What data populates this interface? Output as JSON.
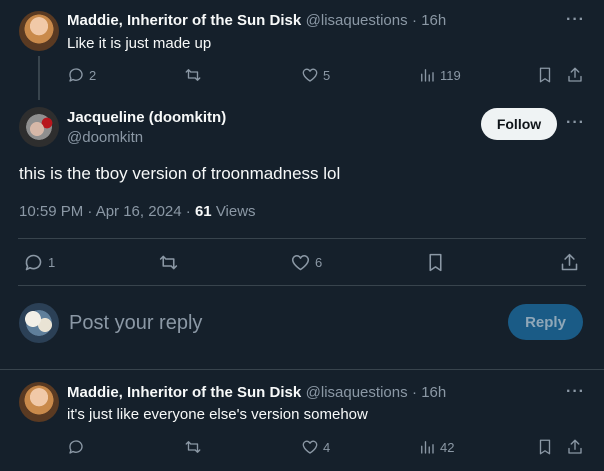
{
  "tweet1": {
    "display_name": "Maddie, Inheritor of the Sun Disk",
    "handle": "@lisaquestions",
    "time": "· 16h",
    "text": "Like it is just made up",
    "replies": "2",
    "retweets": "",
    "likes": "5",
    "views": "119"
  },
  "main": {
    "display_name": "Jacqueline (doomkitn)",
    "handle": "@doomkitn",
    "follow_label": "Follow",
    "text": "this is the tboy version of troonmadness lol",
    "timestamp": "10:59 PM · Apr 16, 2024 ·",
    "views_count": "61",
    "views_label": "Views",
    "replies": "1",
    "likes": "6"
  },
  "composer": {
    "placeholder": "Post your reply",
    "reply_label": "Reply"
  },
  "tweet2": {
    "display_name": "Maddie, Inheritor of the Sun Disk",
    "handle": "@lisaquestions",
    "time": "· 16h",
    "text": "it's just like everyone else's version somehow",
    "likes": "4",
    "views": "42"
  },
  "icons": {
    "reply": "reply-icon",
    "retweet": "retweet-icon",
    "like": "heart-icon",
    "views": "analytics-icon",
    "bookmark": "bookmark-icon",
    "share": "share-icon",
    "more": "more-icon"
  },
  "colors": {
    "background": "#15202b",
    "text": "#f7f9f9",
    "muted": "#8b98a5",
    "divider": "#38444d",
    "follow_bg": "#eff3f4",
    "reply_bg": "#1a5b86"
  },
  "more_glyph": "···"
}
